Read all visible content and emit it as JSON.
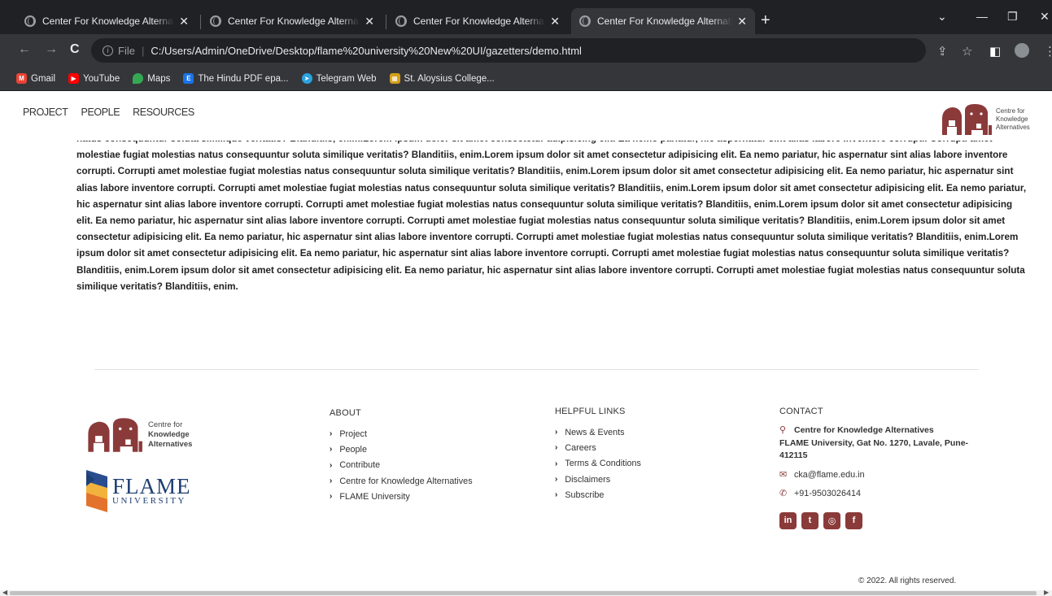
{
  "browser": {
    "tabs": [
      {
        "title": "Center For Knowledge Alternatives",
        "active": false
      },
      {
        "title": "Center For Knowledge Alternatives",
        "active": false
      },
      {
        "title": "Center For Knowledge Alternatives",
        "active": false
      },
      {
        "title": "Center For Knowledge Alternatives",
        "active": true
      }
    ],
    "close_glyph": "✕",
    "new_tab_glyph": "+",
    "address": {
      "scheme_label": "File",
      "url": "C:/Users/Admin/OneDrive/Desktop/flame%20university%20New%20UI/gazetters/demo.html"
    },
    "bookmarks": [
      {
        "label": "Gmail",
        "icon": "gmail-icon",
        "color": "#ea4335"
      },
      {
        "label": "YouTube",
        "icon": "youtube-icon",
        "color": "#ff0000"
      },
      {
        "label": "Maps",
        "icon": "maps-icon",
        "color": "#34a853"
      },
      {
        "label": "The Hindu PDF epa...",
        "icon": "e-icon",
        "color": "#1a73e8"
      },
      {
        "label": "Telegram Web",
        "icon": "telegram-icon",
        "color": "#2aa3e0"
      },
      {
        "label": "St. Aloysius College...",
        "icon": "college-icon",
        "color": "#d4a017"
      }
    ]
  },
  "site": {
    "nav": [
      "PROJECT",
      "PEOPLE",
      "RESOURCES"
    ],
    "logo": {
      "line1": "Centre for",
      "line2": "Knowledge",
      "line3": "Alternatives"
    },
    "brand_color": "#8b3a3a",
    "body_text": "natus consequuntur soluta similique veritatis? Blanditiis, enim.Lorem ipsum dolor sit amet consectetur adipisicing elit. Ea nemo pariatur, hic aspernatur sint alias labore inventore corrupti. Corrupti amet molestiae fugiat molestias natus consequuntur soluta similique veritatis? Blanditiis, enim.Lorem ipsum dolor sit amet consectetur adipisicing elit. Ea nemo pariatur, hic aspernatur sint alias labore inventore corrupti. Corrupti amet molestiae fugiat molestias natus consequuntur soluta similique veritatis? Blanditiis, enim.Lorem ipsum dolor sit amet consectetur adipisicing elit. Ea nemo pariatur, hic aspernatur sint alias labore inventore corrupti. Corrupti amet molestiae fugiat molestias natus consequuntur soluta similique veritatis? Blanditiis, enim.Lorem ipsum dolor sit amet consectetur adipisicing elit. Ea nemo pariatur, hic aspernatur sint alias labore inventore corrupti. Corrupti amet molestiae fugiat molestias natus consequuntur soluta similique veritatis? Blanditiis, enim.Lorem ipsum dolor sit amet consectetur adipisicing elit. Ea nemo pariatur, hic aspernatur sint alias labore inventore corrupti. Corrupti amet molestiae fugiat molestias natus consequuntur soluta similique veritatis? Blanditiis, enim.Lorem ipsum dolor sit amet consectetur adipisicing elit. Ea nemo pariatur, hic aspernatur sint alias labore inventore corrupti. Corrupti amet molestiae fugiat molestias natus consequuntur soluta similique veritatis? Blanditiis, enim.Lorem ipsum dolor sit amet consectetur adipisicing elit. Ea nemo pariatur, hic aspernatur sint alias labore inventore corrupti. Corrupti amet molestiae fugiat molestias natus consequuntur soluta similique veritatis? Blanditiis, enim.Lorem ipsum dolor sit amet consectetur adipisicing elit. Ea nemo pariatur, hic aspernatur sint alias labore inventore corrupti. Corrupti amet molestiae fugiat molestias natus consequuntur soluta similique veritatis? Blanditiis, enim."
  },
  "footer": {
    "flame_logo": {
      "word": "FLAME",
      "sub": "UNIVERSITY"
    },
    "about": {
      "heading": "ABOUT",
      "links": [
        "Project",
        "People",
        "Contribute",
        "Centre for Knowledge Alternatives",
        "FLAME University"
      ]
    },
    "helpful": {
      "heading": "HELPFUL LINKS",
      "links": [
        "News & Events",
        "Careers",
        "Terms & Conditions",
        "Disclaimers",
        "Subscribe"
      ]
    },
    "contact": {
      "heading": "CONTACT",
      "org": "Centre for Knowledge Alternatives",
      "address": "FLAME University, Gat No. 1270, Lavale, Pune-412115",
      "email": "cka@flame.edu.in",
      "phone": "+91-9503026414"
    },
    "socials": [
      {
        "name": "linkedin-icon",
        "glyph": "in"
      },
      {
        "name": "twitter-icon",
        "glyph": "t"
      },
      {
        "name": "instagram-icon",
        "glyph": "◎"
      },
      {
        "name": "facebook-icon",
        "glyph": "f"
      }
    ],
    "copyright": "© 2022. All rights reserved."
  }
}
